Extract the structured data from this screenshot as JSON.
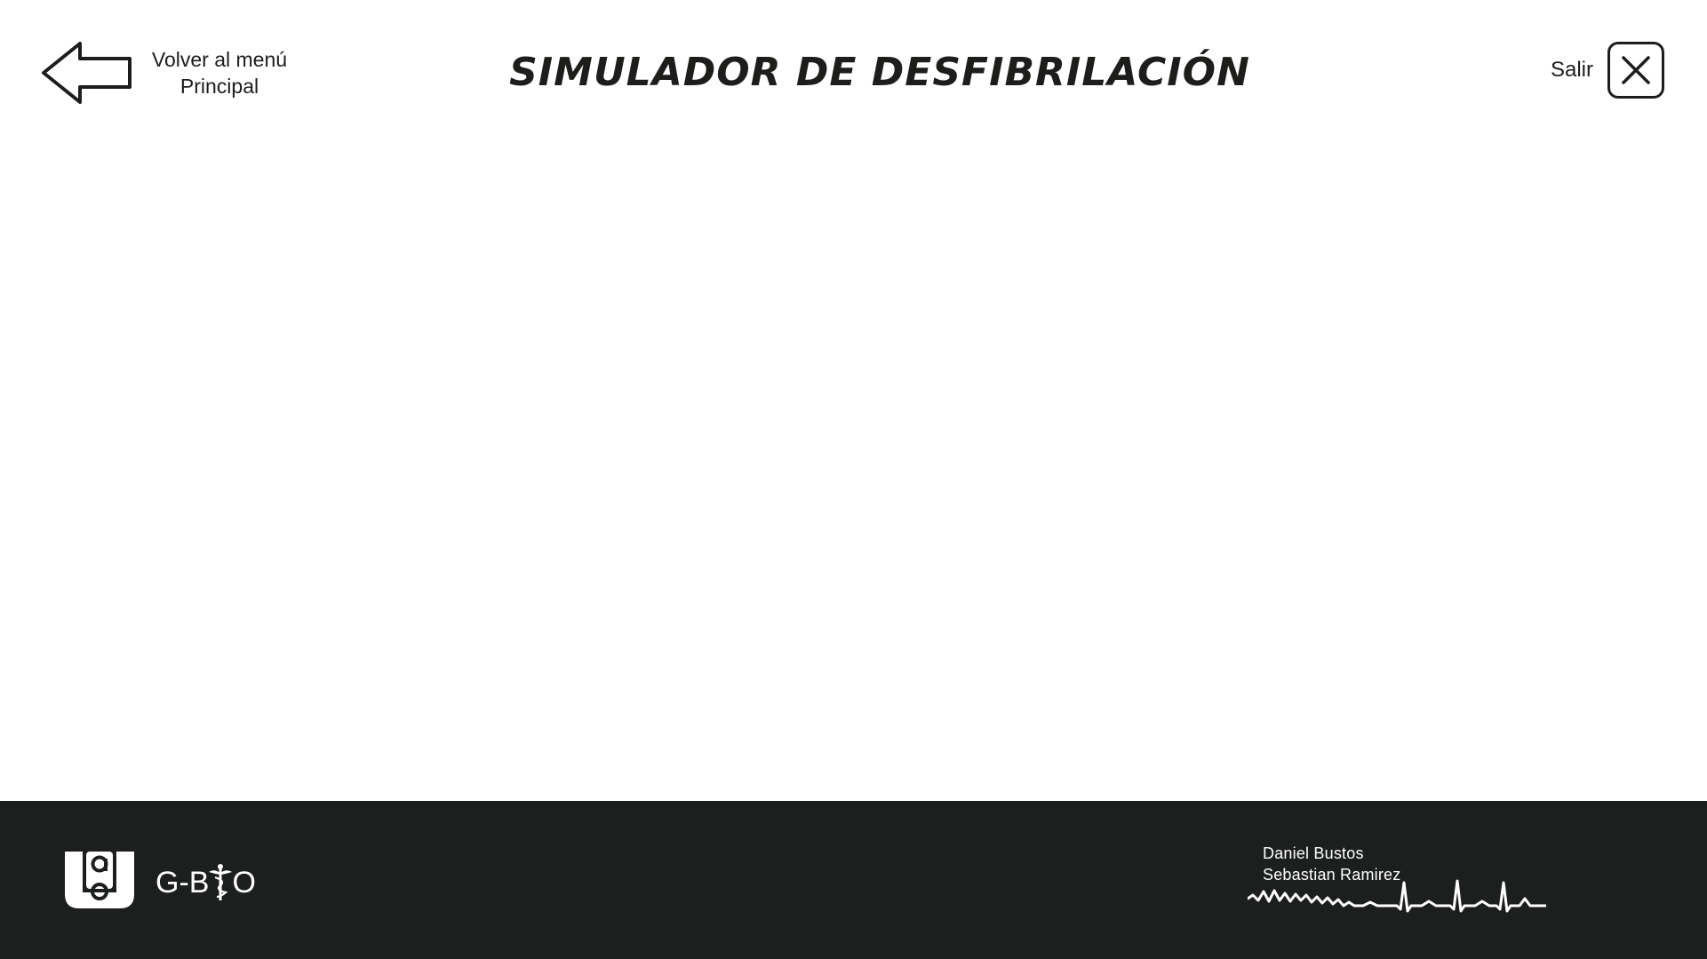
{
  "header": {
    "back_label_line1": "Volver al menú",
    "back_label_line2": "Principal",
    "title": "SIMULADOR DE DESFIBRILACIÓN",
    "exit_label": "Salir"
  },
  "footer": {
    "logo_text": "G-BIO",
    "logo_prefix": "G-B",
    "logo_suffix": "O",
    "authors": [
      "Daniel Bustos",
      "Sebastian Ramirez"
    ]
  },
  "colors": {
    "background": "#ffffff",
    "text": "#1d1d1b",
    "footer_background": "#1d1f1f",
    "footer_text": "#ffffff"
  },
  "icons": {
    "back": "arrow-left-outline-icon",
    "exit": "close-icon",
    "university_logo": "university-logo-icon",
    "caduceus": "caduceus-icon",
    "ecg": "ecg-waveform-icon"
  }
}
